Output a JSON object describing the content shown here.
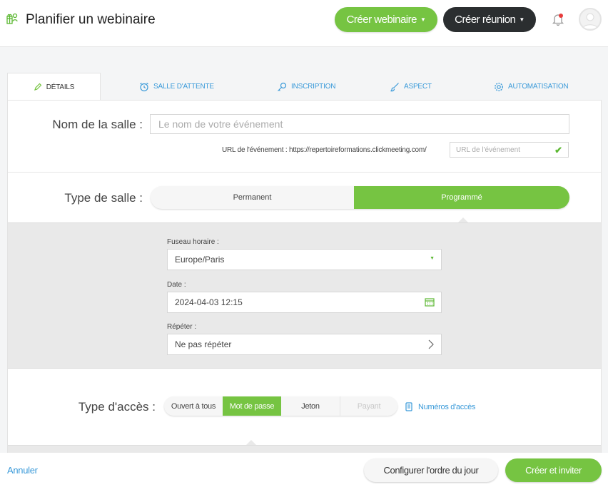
{
  "header": {
    "title": "Planifier un webinaire",
    "create_webinar_label": "Créer webinaire",
    "create_meeting_label": "Créer réunion"
  },
  "tabs": [
    {
      "label": "DÉTAILS",
      "icon": "pencil-icon",
      "active": true
    },
    {
      "label": "SALLE D'ATTENTE",
      "icon": "alarm-clock-icon",
      "active": false
    },
    {
      "label": "INSCRIPTION",
      "icon": "key-icon",
      "active": false
    },
    {
      "label": "ASPECT",
      "icon": "brush-icon",
      "active": false
    },
    {
      "label": "AUTOMATISATION",
      "icon": "gear-icon",
      "active": false
    }
  ],
  "room_name": {
    "label": "Nom de la salle :",
    "placeholder": "Le nom de votre événement"
  },
  "event_url": {
    "prefix": "URL de l'événement : https://repertoireformations.clickmeeting.com/",
    "placeholder": "URL de l'événement"
  },
  "room_type": {
    "label": "Type de salle :",
    "options": [
      "Permanent",
      "Programmé"
    ],
    "selected": "Programmé"
  },
  "schedule": {
    "timezone_label": "Fuseau horaire :",
    "timezone_value": "Europe/Paris",
    "date_label": "Date :",
    "date_value": "2024-04-03 12:15",
    "repeat_label": "Répéter :",
    "repeat_value": "Ne pas répéter"
  },
  "access_type": {
    "label": "Type d'accès :",
    "options": [
      "Ouvert à tous",
      "Mot de passe",
      "Jeton",
      "Payant"
    ],
    "selected": "Mot de passe",
    "disabled": [
      "Payant"
    ],
    "numbers_link": "Numéros d'accès"
  },
  "footer": {
    "cancel_label": "Annuler",
    "agenda_label": "Configurer l'ordre du jour",
    "create_invite_label": "Créer et inviter"
  },
  "colors": {
    "accent_green": "#76c442",
    "link_blue": "#3a9ad9",
    "dark_button": "#2b2e30",
    "notification_dot": "#e83b3b"
  }
}
